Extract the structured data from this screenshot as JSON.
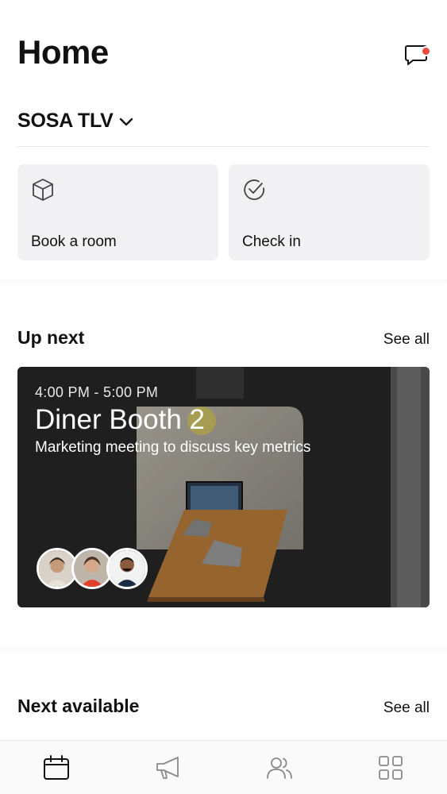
{
  "header": {
    "title": "Home",
    "chat_icon": "chat-bubble-icon",
    "has_notification": true
  },
  "location": {
    "label": "SOSA TLV",
    "icon": "chevron-down-icon"
  },
  "actions": [
    {
      "label": "Book a room",
      "icon": "cube-icon"
    },
    {
      "label": "Check in",
      "icon": "check-circle-icon"
    }
  ],
  "up_next": {
    "title": "Up next",
    "see_all": "See all",
    "event": {
      "time": "4:00 PM - 5:00 PM",
      "room": "Diner Booth 2",
      "description": "Marketing meeting to discuss key metrics",
      "attendees": 3
    }
  },
  "next_available": {
    "title": "Next available",
    "see_all": "See all"
  },
  "tabbar": {
    "items": [
      {
        "icon": "calendar-icon",
        "active": true
      },
      {
        "icon": "megaphone-icon",
        "active": false
      },
      {
        "icon": "people-icon",
        "active": false
      },
      {
        "icon": "grid-icon",
        "active": false
      }
    ]
  },
  "colors": {
    "notification": "#f0473c",
    "card_bg": "#f1f1f3",
    "text": "#111111"
  }
}
